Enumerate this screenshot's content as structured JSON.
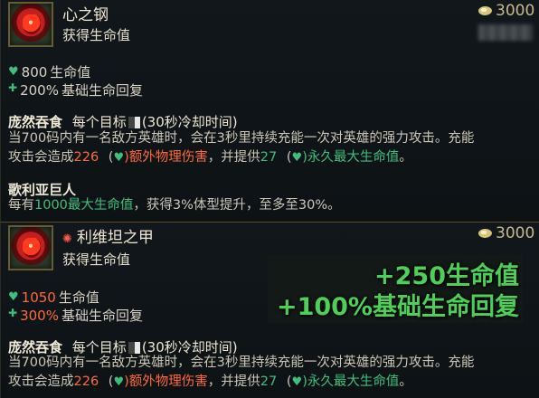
{
  "item1": {
    "name": "心之钢",
    "subtitle": "获得生命值",
    "cost": "3000",
    "stats": [
      {
        "icon": "heart-icon",
        "value": "800",
        "label": "生命值"
      },
      {
        "icon": "regen-icon",
        "value": "200%",
        "label": "基础生命回复"
      }
    ],
    "passive1": {
      "name": "庞然吞食",
      "prefix": "每个目标",
      "cooldown": "(30秒冷却时间)",
      "line1": "当700码内有一名敌方英雄时，会在3秒里持续充能一次对英雄的强力攻击。充能",
      "line2_a": "攻击会造成",
      "line2_dmg": "226",
      "line2_b": "(",
      "line2_c": ")额外物理伤害",
      "line2_d": "，并提供",
      "line2_hp": "27",
      "line2_e": "(",
      "line2_f": ")永久最大生命值",
      "line2_g": "。"
    },
    "passive2": {
      "name": "歌利亚巨人",
      "line_a": "每有",
      "line_hl": "1000最大生命值",
      "line_b": "，获得3%体型提升，至多至30%。"
    }
  },
  "item2": {
    "name": "利维坦之甲",
    "subtitle": "获得生命值",
    "cost": "3000",
    "stats": [
      {
        "icon": "heart-icon",
        "value": "1050",
        "label": "生命值"
      },
      {
        "icon": "regen-icon",
        "value": "300%",
        "label": "基础生命回复"
      }
    ],
    "passive1": {
      "name": "庞然吞食",
      "prefix": "每个目标",
      "cooldown": "(30秒冷却时间)",
      "line1": "当700码内有一名敌方英雄时，会在3秒里持续充能一次对英雄的强力攻击。充能",
      "line2_a": "攻击会造成",
      "line2_dmg": "226",
      "line2_b": "(",
      "line2_c": ")额外物理伤害",
      "line2_d": "，并提供",
      "line2_hp": "27",
      "line2_e": "(",
      "line2_f": ")永久最大生命值",
      "line2_g": "。"
    }
  },
  "overlay": {
    "line1": "+250生命值",
    "line2": "+100%基础生命回复"
  },
  "colors": {
    "accent_green": "#3fbf7a",
    "accent_red": "#ff6a3a",
    "overlay_green": "#4ecf58"
  }
}
